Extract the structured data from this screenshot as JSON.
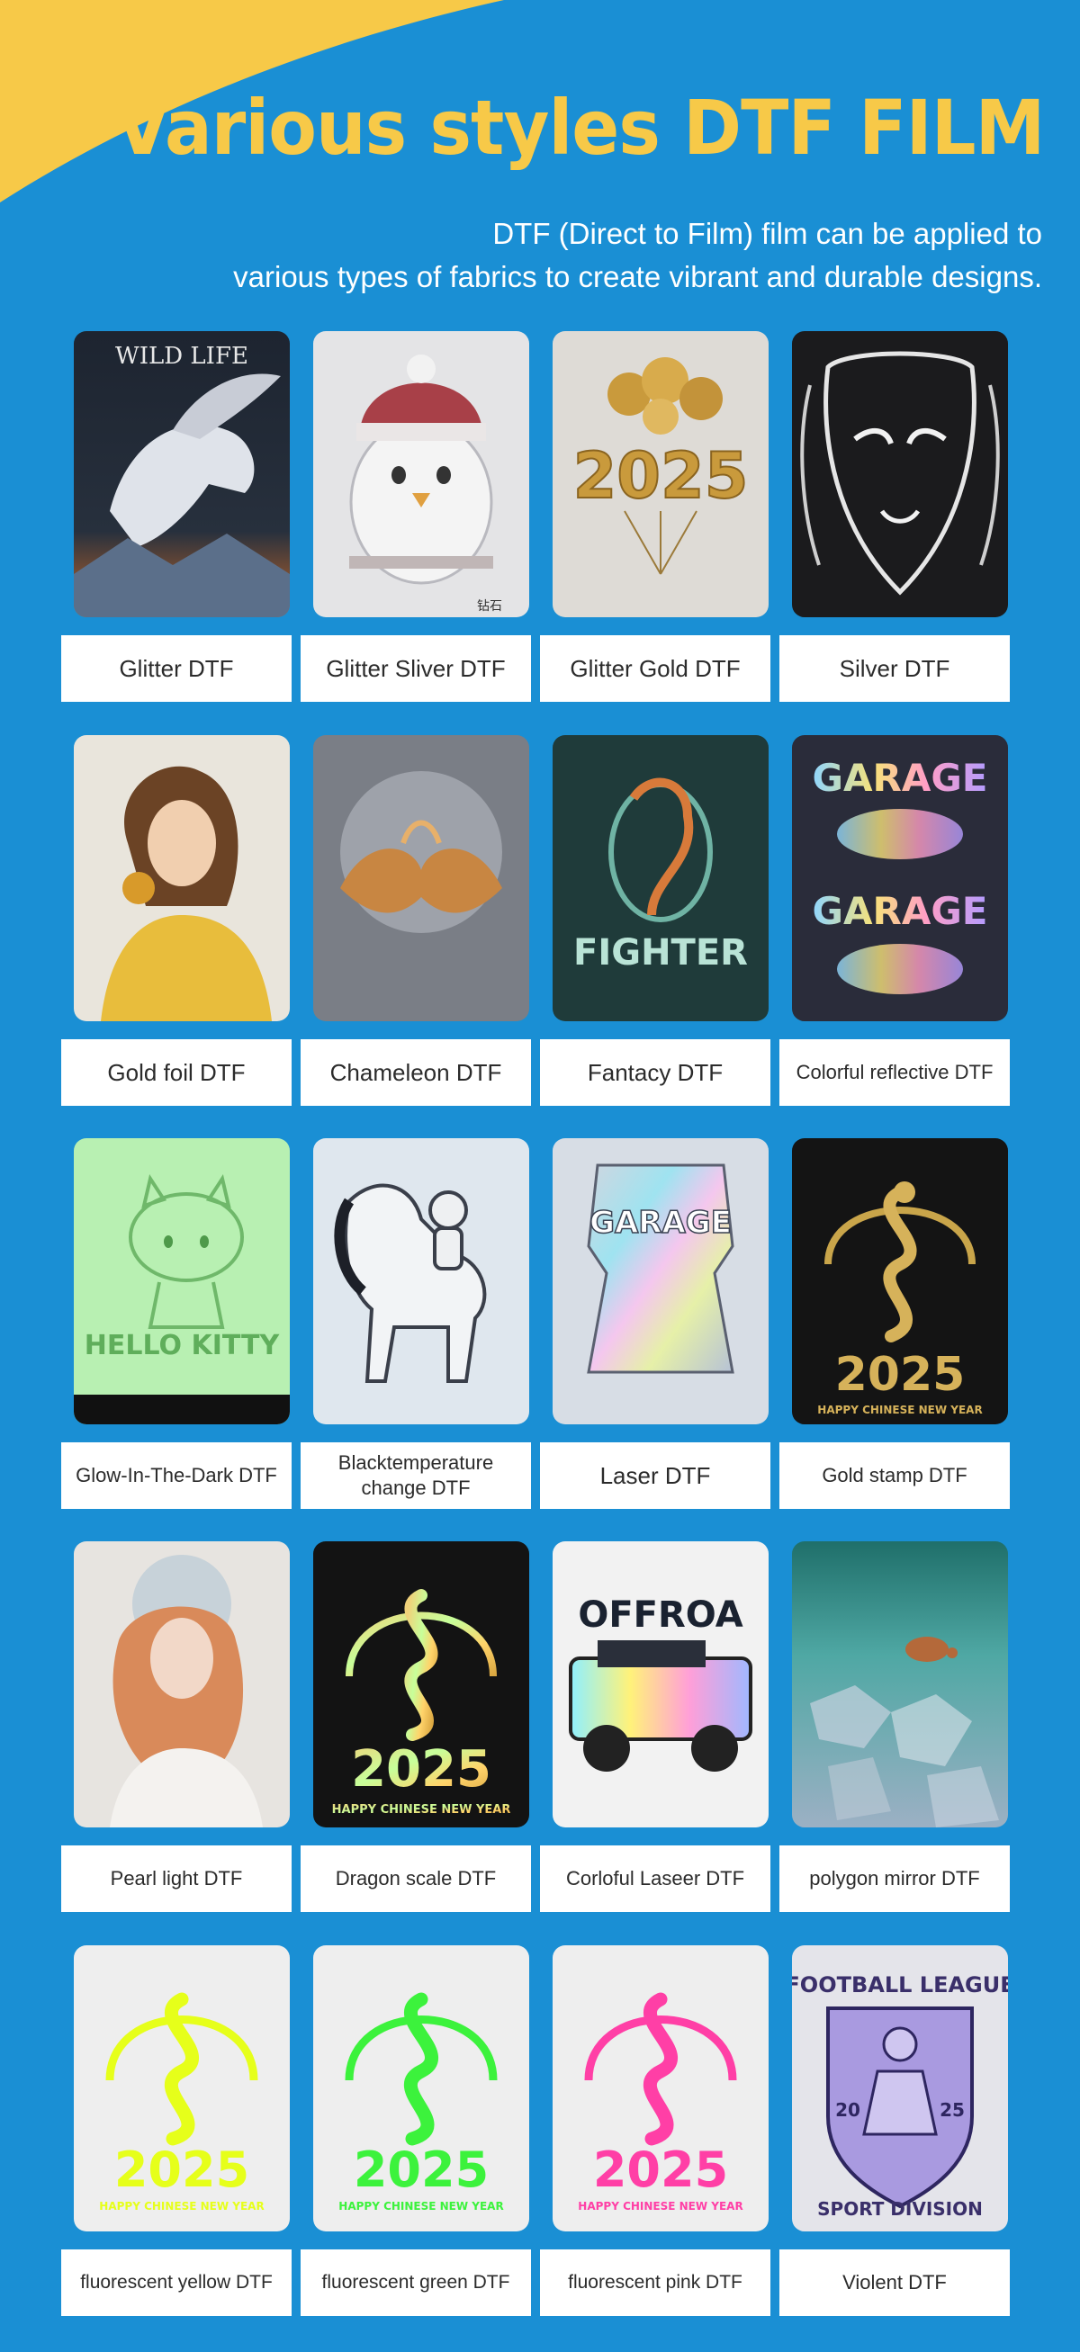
{
  "header": {
    "title": "Various styles DTF FILM",
    "subtitle_line1": "DTF (Direct to Film) film can be applied to",
    "subtitle_line2": "various types of fabrics to create vibrant and durable designs."
  },
  "colors": {
    "background": "#1a8fd4",
    "accent_yellow": "#f7c948",
    "label_bg": "#ffffff",
    "label_text": "#2b2b2b"
  },
  "products": [
    {
      "label": "Glitter DTF",
      "photo_text": "WILD LIFE",
      "icon": "pegasus-icon"
    },
    {
      "label": "Glitter Sliver DTF",
      "photo_text": "钻石",
      "icon": "penguin-icon"
    },
    {
      "label": "Glitter Gold DTF",
      "photo_text": "2025",
      "icon": "balloons-icon"
    },
    {
      "label": "Silver DTF",
      "photo_text": "",
      "icon": "mask-icon"
    },
    {
      "label": "Gold foil DTF",
      "photo_text": "",
      "icon": "woman-portrait-icon"
    },
    {
      "label": "Chameleon DTF",
      "photo_text": "",
      "icon": "koi-fish-icon"
    },
    {
      "label": "Fantacy DTF",
      "photo_text": "FIGHTER",
      "icon": "fish-icon"
    },
    {
      "label": "Colorful reflective DTF",
      "photo_text": "GARAGE",
      "icon": "reflective-text-icon"
    },
    {
      "label": "Glow-In-The-Dark DTF",
      "photo_text": "HELLO KITTY",
      "icon": "kitty-icon"
    },
    {
      "label": "Blacktemperature change DTF",
      "photo_text": "",
      "icon": "horse-astronaut-icon"
    },
    {
      "label": "Laser DTF",
      "photo_text": "GARAGE",
      "icon": "holographic-badge-icon"
    },
    {
      "label": "Gold stamp DTF",
      "photo_text": "2025",
      "photo_text2": "HAPPY CHINESE NEW YEAR",
      "icon": "snake-icon"
    },
    {
      "label": "Pearl light DTF",
      "photo_text": "",
      "icon": "woman-portrait-icon"
    },
    {
      "label": "Dragon scale DTF",
      "photo_text": "2025",
      "photo_text2": "HAPPY CHINESE NEW YEAR",
      "icon": "snake-icon"
    },
    {
      "label": "Corloful Laseer DTF",
      "photo_text": "OFFROA",
      "icon": "jeep-icon"
    },
    {
      "label": "polygon mirror DTF",
      "photo_text": "",
      "icon": "turtle-icon"
    },
    {
      "label": "fluorescent yellow DTF",
      "photo_text": "2025",
      "photo_text2": "HAPPY CHINESE NEW YEAR",
      "icon": "snake-icon"
    },
    {
      "label": "fluorescent green DTF",
      "photo_text": "2025",
      "photo_text2": "HAPPY CHINESE NEW YEAR",
      "icon": "snake-icon"
    },
    {
      "label": "fluorescent pink DTF",
      "photo_text": "2025",
      "photo_text2": "HAPPY CHINESE NEW YEAR",
      "icon": "snake-icon"
    },
    {
      "label": "Violent DTF",
      "photo_text": "FOOTBALL LEAGUE",
      "photo_text2": "SPORT DIVISION",
      "photo_text3": "20",
      "photo_text4": "25",
      "icon": "football-player-icon"
    }
  ]
}
